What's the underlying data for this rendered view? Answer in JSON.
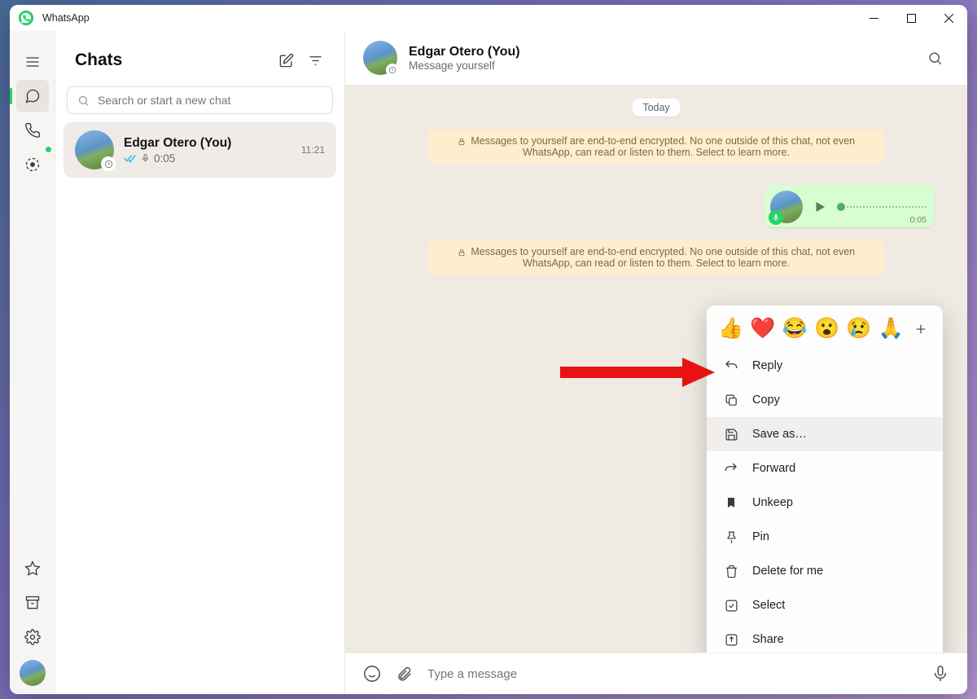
{
  "app": {
    "title": "WhatsApp"
  },
  "sidebar": {
    "items": [
      "menu",
      "chats",
      "calls",
      "status"
    ],
    "bottom": [
      "star",
      "archive",
      "settings",
      "avatar"
    ]
  },
  "chat_list": {
    "title": "Chats",
    "search_placeholder": "Search or start a new chat",
    "items": [
      {
        "name": "Edgar Otero (You)",
        "time": "11:21",
        "preview_icon": "double-check",
        "preview_mic": true,
        "preview_duration": "0:05",
        "selected": true
      }
    ]
  },
  "conversation": {
    "title": "Edgar Otero (You)",
    "subtitle": "Message yourself",
    "date_label": "Today",
    "encrypt_banner": "Messages to yourself are end-to-end encrypted. No one outside of this chat, not even WhatsApp, can read or listen to them. Select to learn more.",
    "voice_message": {
      "duration": "0:05"
    }
  },
  "context_menu": {
    "reactions": [
      "👍",
      "❤️",
      "😂",
      "😮",
      "😢",
      "🙏"
    ],
    "items": [
      {
        "icon": "reply",
        "label": "Reply"
      },
      {
        "icon": "copy",
        "label": "Copy"
      },
      {
        "icon": "save",
        "label": "Save as…",
        "hover": true
      },
      {
        "icon": "forward",
        "label": "Forward"
      },
      {
        "icon": "bookmark",
        "label": "Unkeep"
      },
      {
        "icon": "pin",
        "label": "Pin"
      },
      {
        "icon": "trash",
        "label": "Delete for me"
      },
      {
        "icon": "select",
        "label": "Select"
      },
      {
        "icon": "share",
        "label": "Share"
      }
    ]
  },
  "composer": {
    "placeholder": "Type a message"
  }
}
